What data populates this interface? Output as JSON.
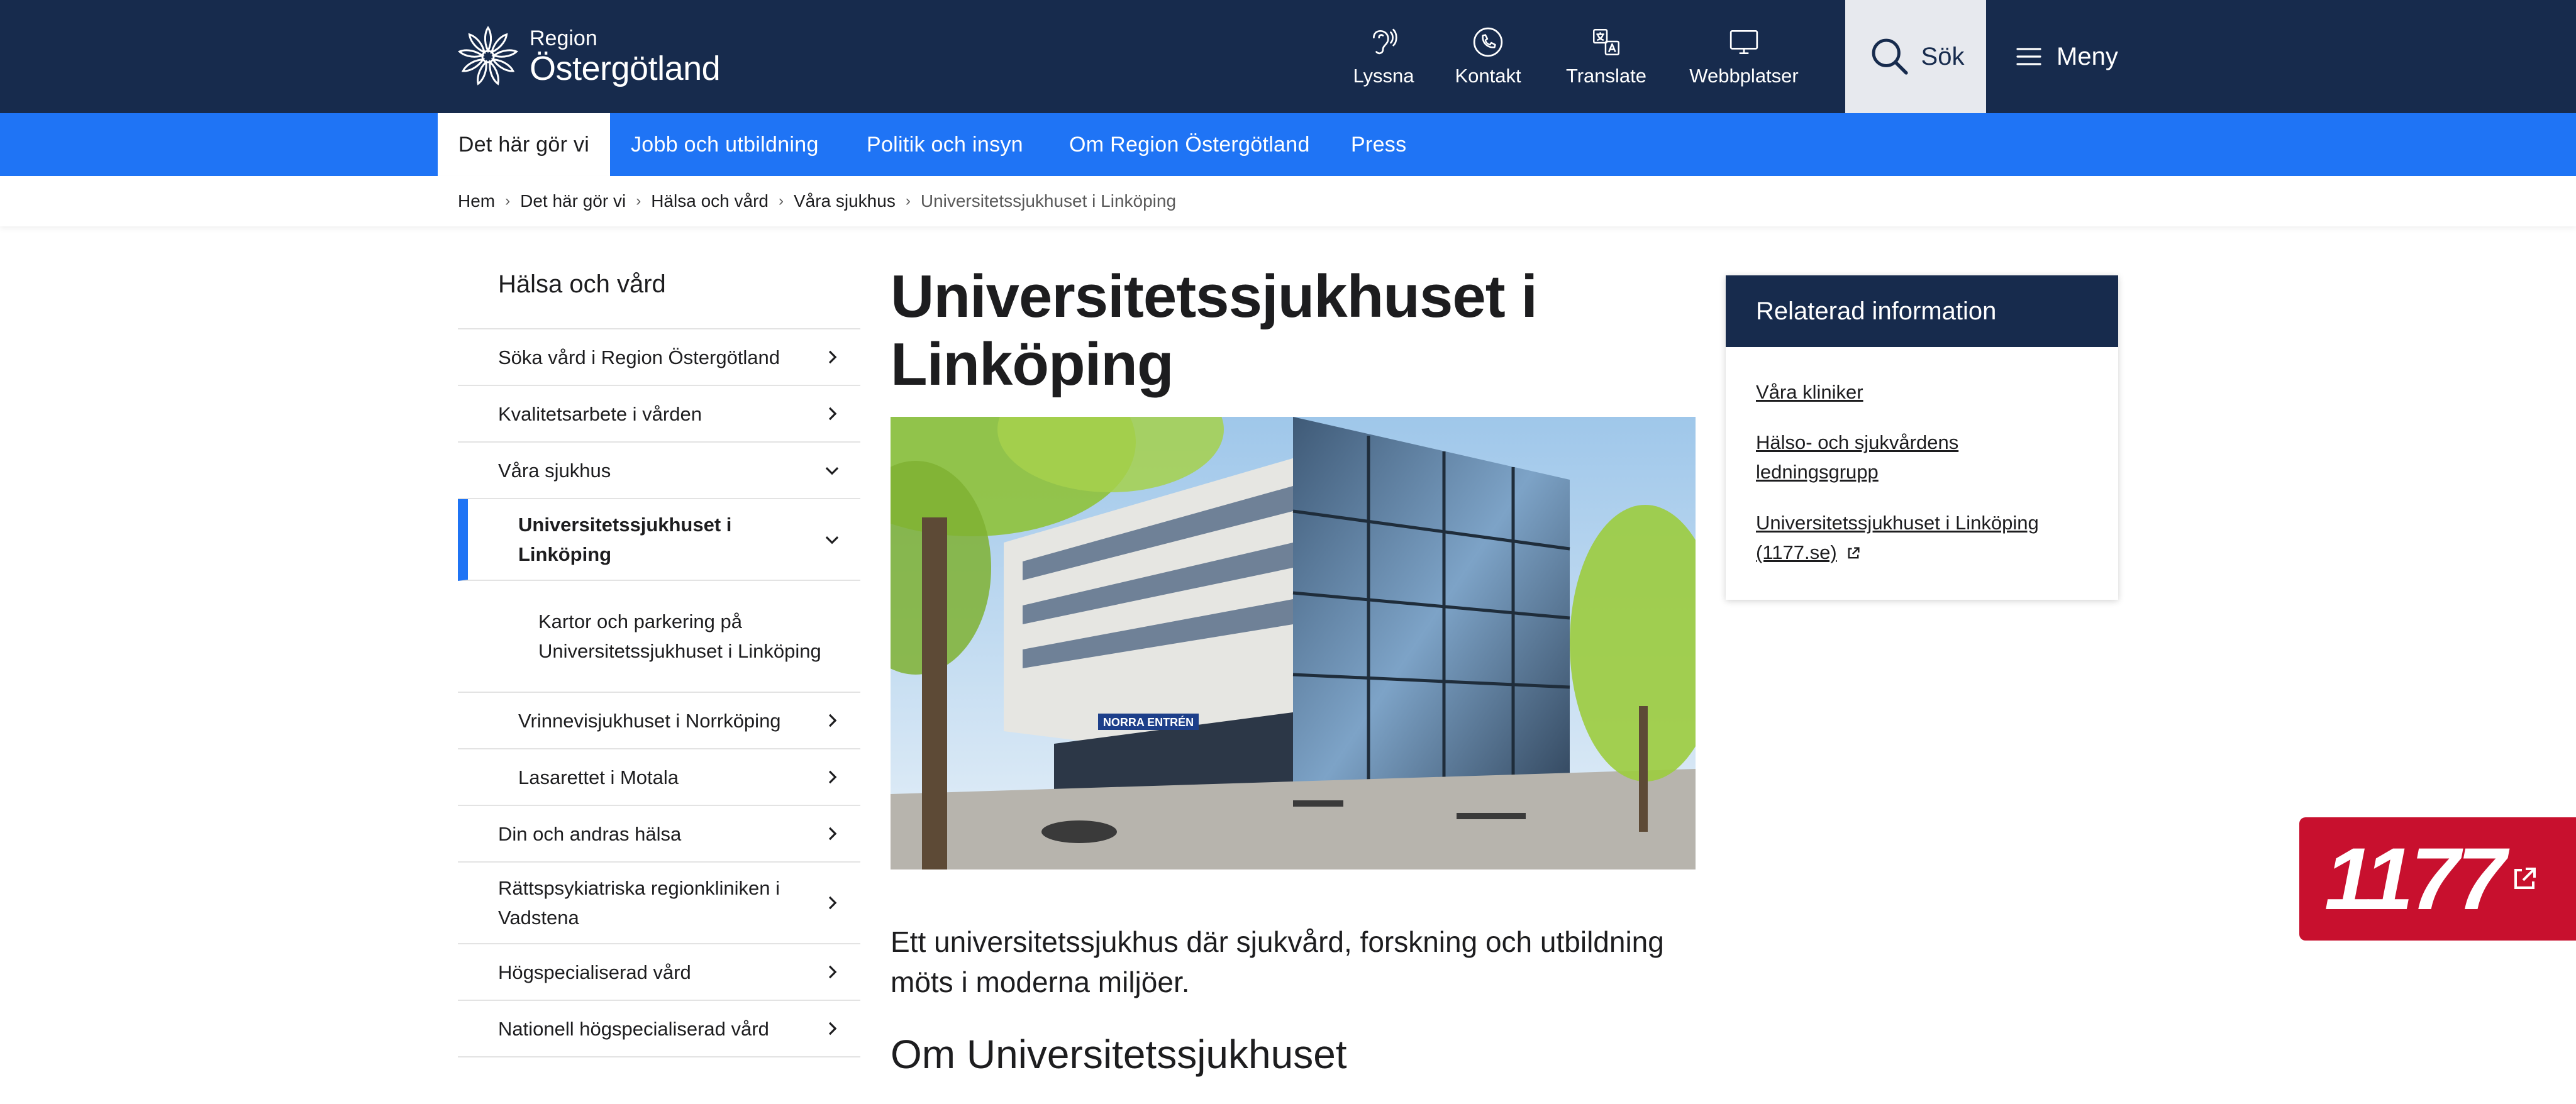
{
  "header": {
    "logo_small": "Region",
    "logo_big": "Östergötland",
    "utilities": [
      {
        "label": "Lyssna",
        "icon": "listen-icon"
      },
      {
        "label": "Kontakt",
        "icon": "phone-icon"
      },
      {
        "label": "Translate",
        "icon": "translate-icon"
      },
      {
        "label": "Webbplatser",
        "icon": "monitor-icon"
      }
    ],
    "search_label": "Sök",
    "menu_label": "Meny"
  },
  "nav": {
    "items": [
      "Det här gör vi",
      "Jobb och utbildning",
      "Politik och insyn",
      "Om Region Östergötland",
      "Press"
    ],
    "active_index": 0
  },
  "breadcrumb": [
    "Hem",
    "Det här gör vi",
    "Hälsa och vård",
    "Våra sjukhus",
    "Universitetssjukhuset i Linköping"
  ],
  "sidebar": {
    "title": "Hälsa och vård",
    "items": [
      {
        "label": "Söka vård i Region Östergötland",
        "chevron": "right"
      },
      {
        "label": "Kvalitetsarbete i vården",
        "chevron": "right"
      },
      {
        "label": "Våra sjukhus",
        "chevron": "down"
      },
      {
        "label": "Universitetssjukhuset i Linköping",
        "chevron": "down",
        "active": true
      },
      {
        "label": "Kartor och parkering på Universitetssjukhuset i Linköping",
        "chevron": "none"
      },
      {
        "label": "Vrinnevisjukhuset i Norrköping",
        "chevron": "right"
      },
      {
        "label": "Lasarettet i Motala",
        "chevron": "right"
      },
      {
        "label": "Din och andras hälsa",
        "chevron": "right"
      },
      {
        "label": "Rättspsykiatriska regionkliniken i Vadstena",
        "chevron": "right"
      },
      {
        "label": "Högspecialiserad vård",
        "chevron": "right"
      },
      {
        "label": "Nationell högspecialiserad vård",
        "chevron": "right"
      }
    ]
  },
  "main": {
    "title": "Universitetssjukhuset i Linköping",
    "image_sign": "NORRA ENTRÉN",
    "lead": "Ett universitetssjukhus där sjukvård, forskning och utbildning möts i moderna miljöer.",
    "section_heading": "Om Universitetssjukhuset"
  },
  "related": {
    "heading": "Relaterad information",
    "links": [
      {
        "label": "Våra kliniker",
        "external": false
      },
      {
        "label": "Hälso- och sjukvårdens ledningsgrupp",
        "external": false
      },
      {
        "label": "Universitetssjukhuset i Linköping (1177.se)",
        "external": true
      }
    ]
  },
  "badge": {
    "label": "1177"
  },
  "colors": {
    "dark_blue": "#172b4d",
    "nav_blue": "#1f74f5",
    "badge_red": "#c8102e"
  }
}
